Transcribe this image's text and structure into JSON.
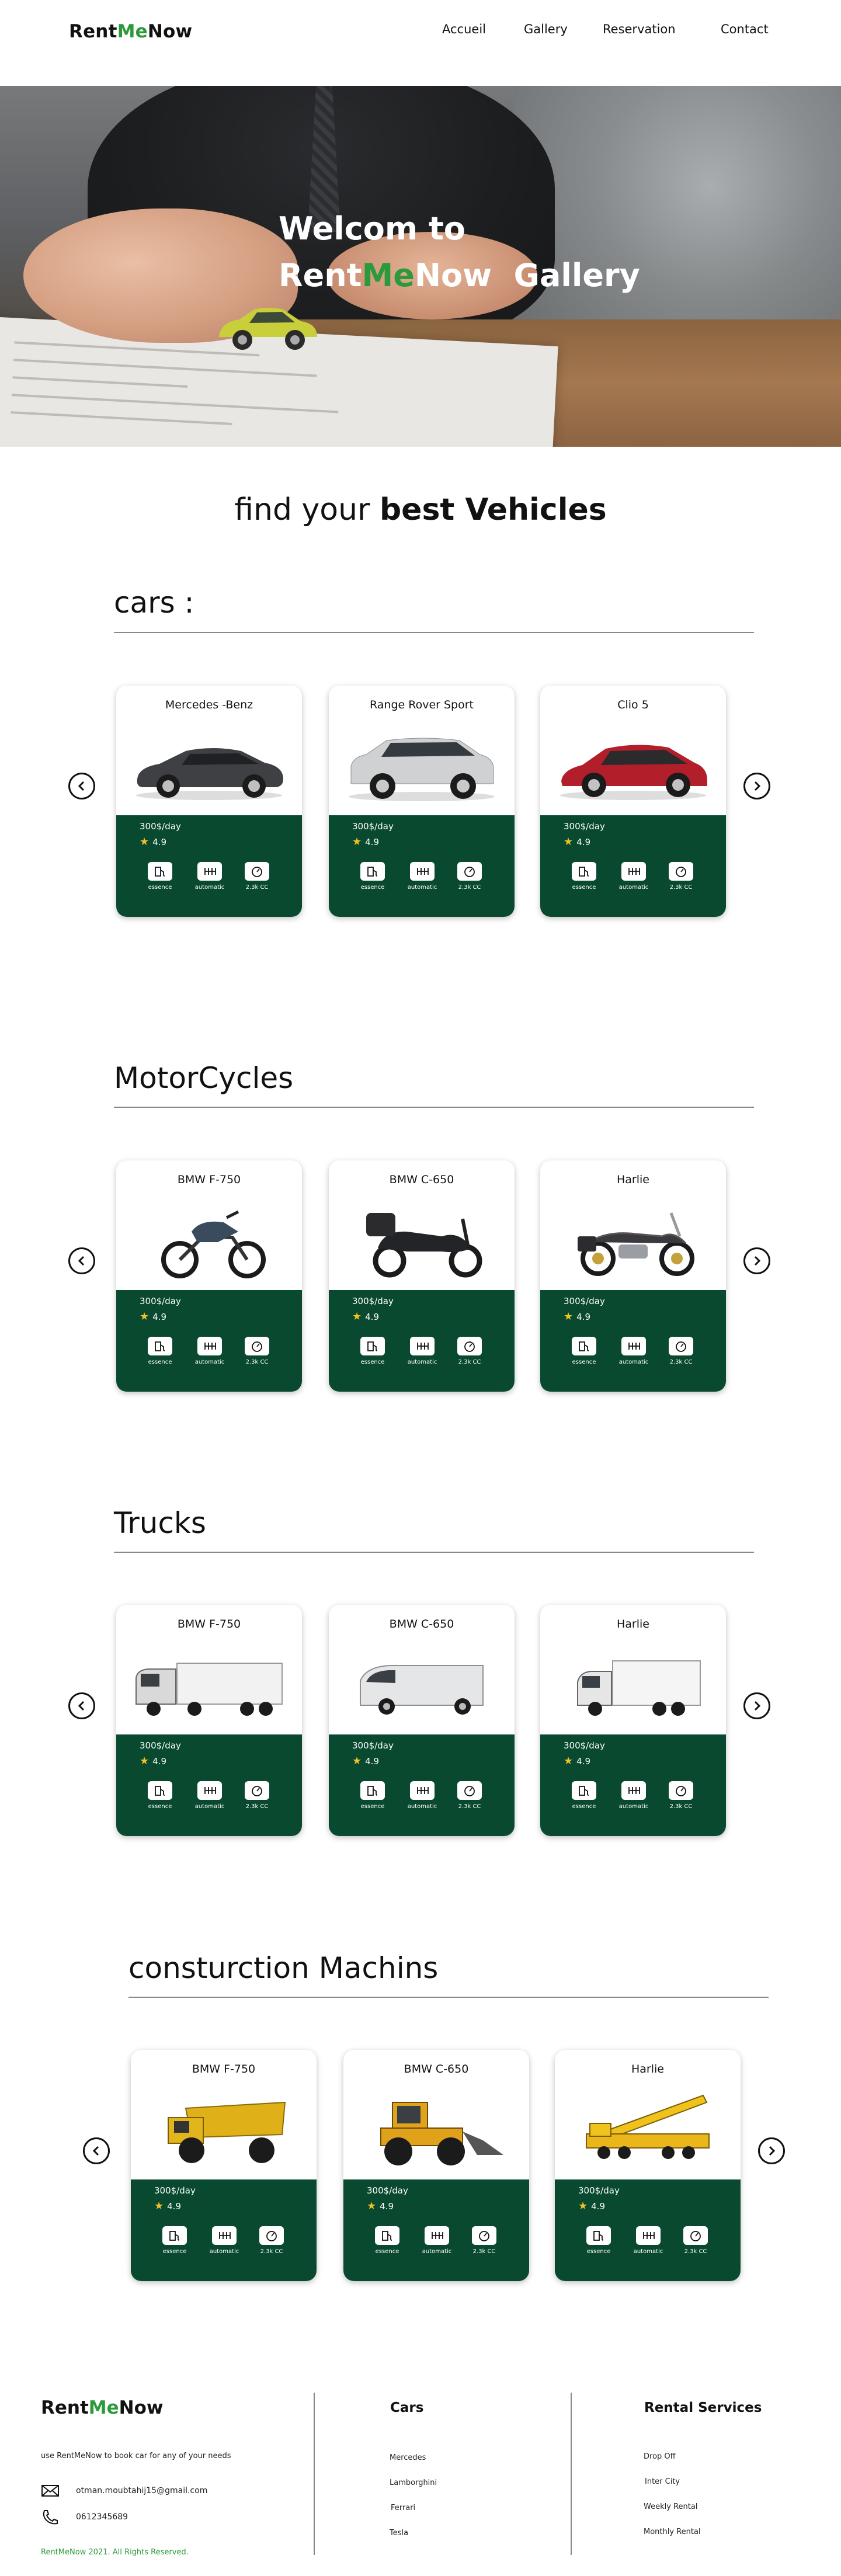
{
  "header": {
    "logo": {
      "part1": "Rent",
      "part2": "Me",
      "part3": "Now"
    },
    "nav": [
      "Accueil",
      "Gallery",
      "Reservation",
      "Contact"
    ]
  },
  "hero": {
    "line1": "Welcom to",
    "brand1": "Rent",
    "brand2": "Me",
    "brand3": "Now",
    "gallery": "Gallery"
  },
  "tagline": {
    "normal": "find your ",
    "bold": "best Vehicles"
  },
  "colors": {
    "brand_green": "#2a9a3a",
    "card_green": "#08492f",
    "star": "#f2c224"
  },
  "features": [
    "essence",
    "automatic",
    "2.3k CC"
  ],
  "sections": [
    {
      "title": "cars :",
      "cards": [
        {
          "name": "Mercedes -Benz",
          "price": "300$/day",
          "rating": "4.9",
          "image": "sedan-car-dark-gray"
        },
        {
          "name": "Range Rover Sport",
          "price": "300$/day",
          "rating": "4.9",
          "image": "suv-white"
        },
        {
          "name": "Clio 5",
          "price": "300$/day",
          "rating": "4.9",
          "image": "hatchback-red"
        }
      ]
    },
    {
      "title": "MotorCycles",
      "cards": [
        {
          "name": "BMW F-750",
          "price": "300$/day",
          "rating": "4.9",
          "image": "adventure-motorcycle"
        },
        {
          "name": "BMW C-650",
          "price": "300$/day",
          "rating": "4.9",
          "image": "scooter-black"
        },
        {
          "name": "Harlie",
          "price": "300$/day",
          "rating": "4.9",
          "image": "cruiser-motorcycle"
        }
      ]
    },
    {
      "title": "Trucks",
      "cards": [
        {
          "name": "BMW F-750",
          "price": "300$/day",
          "rating": "4.9",
          "image": "semi-truck"
        },
        {
          "name": "BMW C-650",
          "price": "300$/day",
          "rating": "4.9",
          "image": "van-white"
        },
        {
          "name": "Harlie",
          "price": "300$/day",
          "rating": "4.9",
          "image": "box-truck"
        }
      ]
    },
    {
      "title": "consturction Machins",
      "cards": [
        {
          "name": "BMW F-750",
          "price": "300$/day",
          "rating": "4.9",
          "image": "dump-truck"
        },
        {
          "name": "BMW C-650",
          "price": "300$/day",
          "rating": "4.9",
          "image": "wheel-loader"
        },
        {
          "name": "Harlie",
          "price": "300$/day",
          "rating": "4.9",
          "image": "mobile-crane"
        }
      ]
    }
  ],
  "footer": {
    "logo": {
      "part1": "Rent",
      "part2": "Me",
      "part3": "Now"
    },
    "description": "use RentMeNow to book car for any of your needs",
    "email": "otman.moubtahij15@gmail.com",
    "phone": "0612345689",
    "copyright": "RentMeNow 2021. All Rights Reserved.",
    "cars_title": "Cars",
    "cars": [
      "Mercedes",
      "Lamborghini",
      "Ferrari",
      "Tesla"
    ],
    "services_title": "Rental  Services",
    "services": [
      "Drop Off",
      "Inter City",
      "Weekly Rental",
      "Monthly Rental"
    ]
  }
}
